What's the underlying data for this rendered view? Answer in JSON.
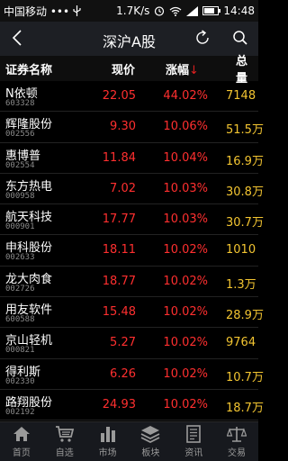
{
  "status_bar": {
    "carrier": "中国移动 •••",
    "speed": "1.7K/s",
    "time": "14:48"
  },
  "title_bar": {
    "title": "深沪A股"
  },
  "table_header": {
    "name": "证券名称",
    "price": "现价",
    "change": "涨幅",
    "sort_arrow": "↓",
    "total": "总量"
  },
  "rows": [
    {
      "name": "N依顿",
      "code": "603328",
      "price": "22.05",
      "change": "44.02%",
      "total": "7148"
    },
    {
      "name": "辉隆股份",
      "code": "002556",
      "price": "9.30",
      "change": "10.06%",
      "total": "51.5万"
    },
    {
      "name": "惠博普",
      "code": "002554",
      "price": "11.84",
      "change": "10.04%",
      "total": "16.9万"
    },
    {
      "name": "东方热电",
      "code": "000958",
      "price": "7.02",
      "change": "10.03%",
      "total": "30.8万"
    },
    {
      "name": "航天科技",
      "code": "000901",
      "price": "17.77",
      "change": "10.03%",
      "total": "30.7万"
    },
    {
      "name": "申科股份",
      "code": "002633",
      "price": "18.11",
      "change": "10.02%",
      "total": "1010"
    },
    {
      "name": "龙大肉食",
      "code": "002726",
      "price": "18.77",
      "change": "10.02%",
      "total": "1.3万"
    },
    {
      "name": "用友软件",
      "code": "600588",
      "price": "15.48",
      "change": "10.02%",
      "total": "28.9万"
    },
    {
      "name": "京山轻机",
      "code": "000821",
      "price": "5.27",
      "change": "10.02%",
      "total": "9764"
    },
    {
      "name": "得利斯",
      "code": "002330",
      "price": "6.26",
      "change": "10.02%",
      "total": "10.7万"
    },
    {
      "name": "路翔股份",
      "code": "002192",
      "price": "24.93",
      "change": "10.02%",
      "total": "18.7万"
    }
  ],
  "tab_bar": [
    {
      "label": "首页",
      "icon": "home-icon"
    },
    {
      "label": "自选",
      "icon": "cart-icon"
    },
    {
      "label": "市场",
      "icon": "bar-chart-icon"
    },
    {
      "label": "板块",
      "icon": "layers-icon"
    },
    {
      "label": "资讯",
      "icon": "news-icon"
    },
    {
      "label": "交易",
      "icon": "scale-icon"
    }
  ],
  "colors": {
    "up": "#ff2f2f",
    "volume": "#f3c531",
    "code": "#8a8a8a"
  }
}
